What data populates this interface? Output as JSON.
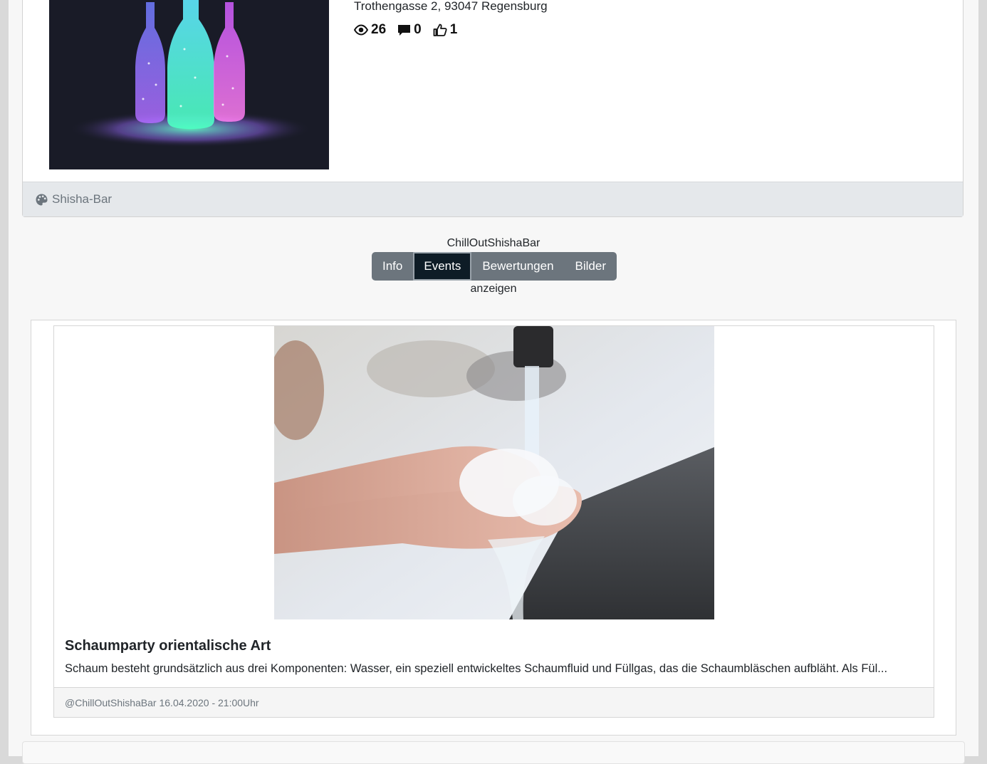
{
  "venue": {
    "address": "Trothengasse 2, 93047 Regensburg",
    "stats": {
      "views": "26",
      "comments": "0",
      "likes": "1"
    },
    "category_icon": "palette-icon",
    "category": "Shisha-Bar"
  },
  "switcher": {
    "label_top": "ChillOutShishaBar",
    "tabs": [
      {
        "label": "Info",
        "active": false
      },
      {
        "label": "Events",
        "active": true
      },
      {
        "label": "Bewertungen",
        "active": false
      },
      {
        "label": "Bilder",
        "active": false
      }
    ],
    "label_bottom": "anzeigen"
  },
  "event": {
    "title": "Schaumparty orientalische Art",
    "description": "Schaum besteht grundsätzlich aus drei Komponenten: Wasser, ein speziell entwickeltes Schaumfluid und Füllgas, das die Schaumbläschen aufbläht. Als Fül...",
    "footer": "@ChillOutShishaBar 16.04.2020 - 21:00Uhr"
  },
  "colors": {
    "active_tab": "#0e1c26",
    "tab_group": "#6c757d",
    "footer_bg": "#e5e8eb"
  }
}
